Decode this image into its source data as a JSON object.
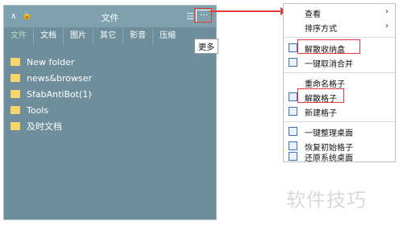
{
  "fence": {
    "title": "文件",
    "more_label": "···",
    "tooltip": "更多",
    "tabs": [
      "文件",
      "文档",
      "图片",
      "其它",
      "影音",
      "压缩"
    ],
    "files": [
      "New folder",
      "news&browser",
      "SfabAntiBot(1)",
      "Tools",
      "及时文档"
    ]
  },
  "menu": {
    "items": [
      {
        "label": "查看",
        "submenu": true,
        "icon": ""
      },
      {
        "label": "排序方式",
        "submenu": true,
        "icon": ""
      },
      {
        "label": "解散收纳盒",
        "submenu": false,
        "icon": "box-icon"
      },
      {
        "label": "一键取消合并",
        "submenu": false,
        "icon": "unmerge-icon"
      },
      {
        "label": "重命名格子",
        "submenu": false,
        "icon": ""
      },
      {
        "label": "解散格子",
        "submenu": false,
        "icon": "grid-icon"
      },
      {
        "label": "新建格子",
        "submenu": false,
        "icon": "new-grid-icon"
      },
      {
        "label": "一键整理桌面",
        "submenu": false,
        "icon": "tidy-icon"
      },
      {
        "label": "恢复初始格子",
        "submenu": false,
        "icon": "restore-icon"
      },
      {
        "label": "还原系统桌面",
        "submenu": false,
        "icon": "desktop-icon"
      }
    ],
    "chevron": "›"
  },
  "watermark": "软件技巧",
  "colors": {
    "highlight": "#e33a3a",
    "panel": "#6e8e9c",
    "folder": "#f6d56a"
  }
}
